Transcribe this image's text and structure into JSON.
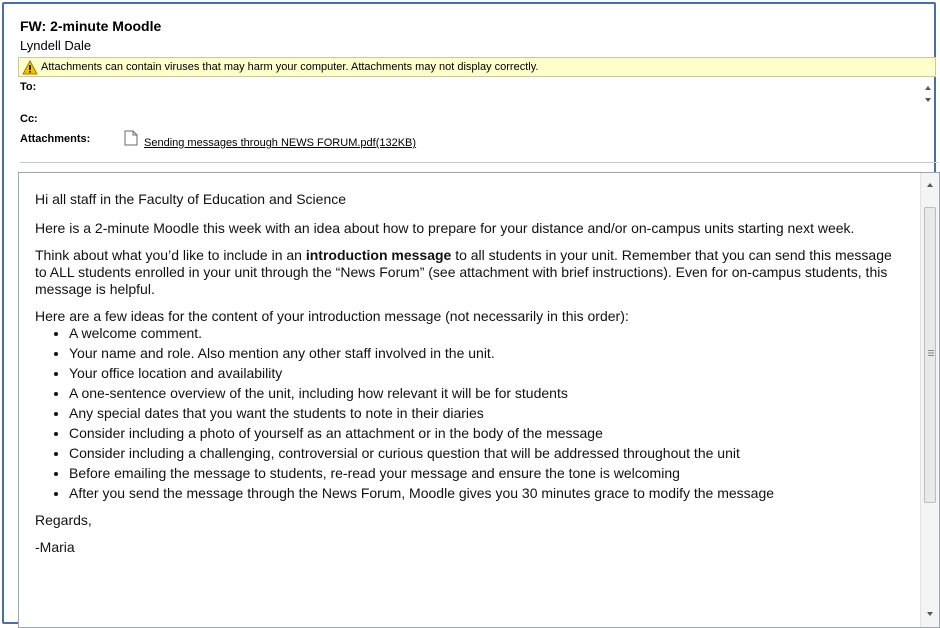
{
  "message": {
    "subject": "FW: 2-minute Moodle",
    "sender": "Lyndell Dale",
    "warning": "Attachments can contain viruses that may harm your computer. Attachments may not display correctly.",
    "to_label": "To:",
    "cc_label": "Cc:",
    "attachments_label": "Attachments:",
    "attachment": {
      "name": "Sending messages through NEWS FORUM.pdf(132KB)",
      "icon": "document-icon"
    }
  },
  "body": {
    "greeting": "Hi all staff in the Faculty of Education and Science",
    "para1": "Here is a 2-minute Moodle this week with an idea about how to prepare for your distance and/or on-campus units starting next week.",
    "para2_before": "Think about what you’d like to include in an ",
    "para2_bold": "introduction message",
    "para2_after": " to all students in your unit. Remember that you can send this message to ALL students enrolled in your unit through the “News Forum” (see attachment with brief instructions). Even for on-campus students, this message is helpful.",
    "list_intro": "Here are a few ideas for the content of your introduction message (not necessarily in this order):",
    "ideas": [
      "A welcome comment.",
      "Your name and role. Also mention any other staff involved in the unit.",
      "Your office location and availability",
      "A one-sentence overview of the unit, including how relevant it will be for students",
      "Any special dates that you want the students to note in their diaries",
      "Consider including a photo of yourself as an attachment or in the body of the message",
      "Consider including a challenging, controversial or curious question that will be addressed throughout the unit",
      "Before emailing the message to students, re-read your message and ensure the tone is welcoming",
      "After you send the message through the News Forum, Moodle gives you 30 minutes grace to modify the message"
    ],
    "closing": "Regards,",
    "signature": "-Maria"
  },
  "colors": {
    "frame_border": "#4a6fa5",
    "warning_bg": "#ffffcc",
    "warning_icon": "#f2c200"
  }
}
